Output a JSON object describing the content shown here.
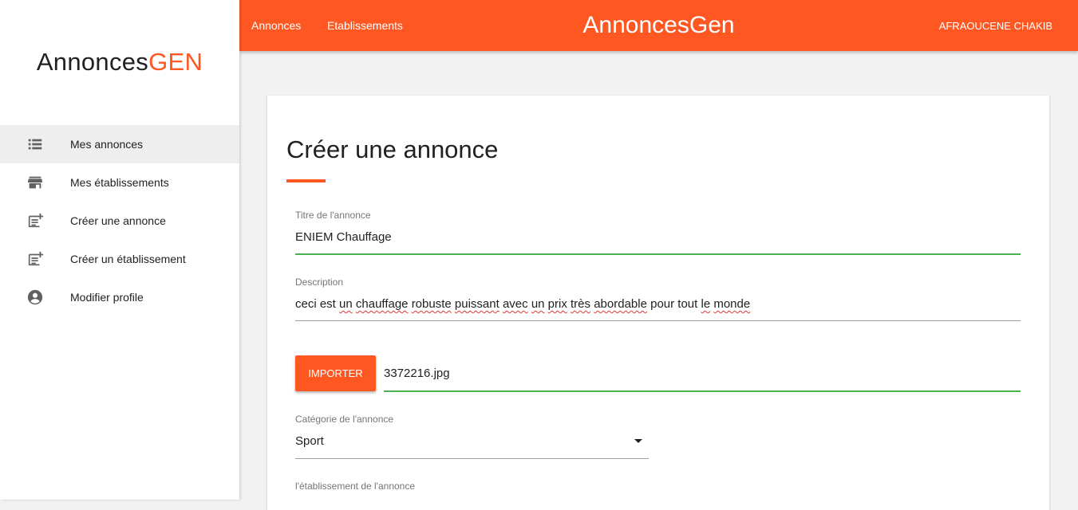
{
  "sidebar": {
    "logo_main": "Annonces",
    "logo_accent": "GEN",
    "items": [
      {
        "label": "Mes annonces",
        "icon": "list-icon"
      },
      {
        "label": "Mes établissements",
        "icon": "store-icon"
      },
      {
        "label": "Créer une annonce",
        "icon": "note-add-icon"
      },
      {
        "label": "Créer un établissement",
        "icon": "note-add-icon"
      },
      {
        "label": "Modifier profile",
        "icon": "account-circle-icon"
      }
    ]
  },
  "header": {
    "links": [
      "Annonces",
      "Etablissements"
    ],
    "brand": "AnnoncesGen",
    "user": "AFRAOUCENE CHAKIB"
  },
  "form": {
    "title": "Créer une annonce",
    "titre_label": "Titre de l'annonce",
    "titre_value": "ENIEM Chauffage",
    "description_label": "Description",
    "description_value": "ceci est un chauffage robuste puissant avec un prix très abordable pour tout le monde",
    "import_label": "IMPORTER",
    "file_name": "3372216.jpg",
    "categorie_label": "Catégorie de l'annonce",
    "categorie_value": "Sport",
    "etablissement_label": "l'établissement de l'annonce"
  },
  "colors": {
    "accent": "#ff5722",
    "valid": "#4caf50"
  }
}
